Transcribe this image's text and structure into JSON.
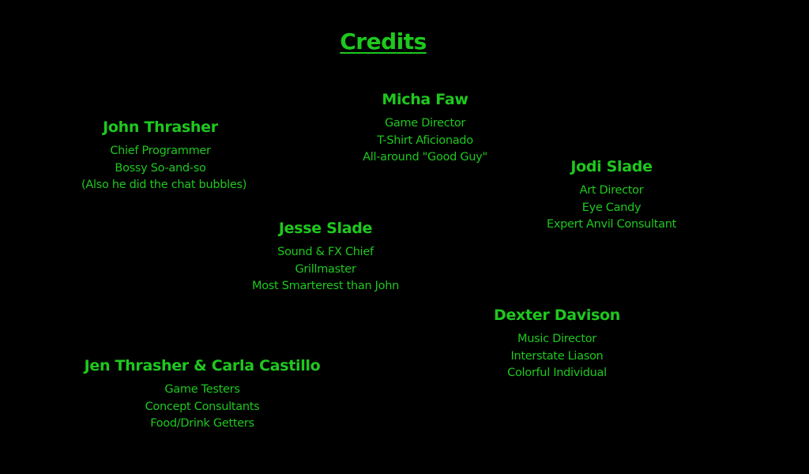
{
  "title": "Credits",
  "colors": {
    "background": "#000000",
    "text": "#1ec81e"
  },
  "credits": {
    "micha": {
      "name": "Micha Faw",
      "roles": [
        "Game Director",
        "T-Shirt Aficionado",
        "All-around \"Good Guy\""
      ]
    },
    "john": {
      "name": "John Thrasher",
      "roles": [
        "Chief Programmer",
        "Bossy So-and-so",
        "(Also he did the chat bubbles)"
      ]
    },
    "jodi": {
      "name": "Jodi Slade",
      "roles": [
        "Art Director",
        "Eye Candy",
        "Expert Anvil Consultant"
      ]
    },
    "jesse": {
      "name": "Jesse Slade",
      "roles": [
        "Sound & FX Chief",
        "Grillmaster",
        "Most Smarterest than John"
      ]
    },
    "dexter": {
      "name": "Dexter Davison",
      "roles": [
        "Music Director",
        "Interstate Liason",
        "Colorful Individual"
      ]
    },
    "jen": {
      "name": "Jen Thrasher & Carla Castillo",
      "roles": [
        "Game Testers",
        "Concept Consultants",
        "Food/Drink Getters"
      ]
    }
  }
}
